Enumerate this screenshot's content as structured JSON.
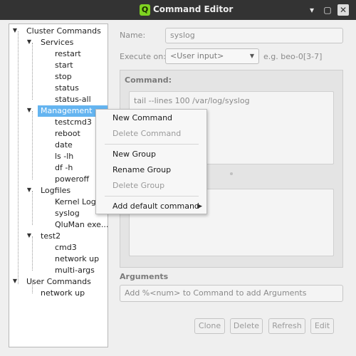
{
  "window": {
    "title": "Command Editor",
    "app_icon_letter": "Q",
    "minimize_glyph": "▾",
    "maximize_glyph": "▢",
    "close_glyph": "✕"
  },
  "tree": {
    "cluster_commands": "Cluster Commands",
    "services": "Services",
    "services_items": [
      "restart",
      "start",
      "stop",
      "status",
      "status-all"
    ],
    "management": "Management",
    "management_items": [
      "testcmd3",
      "reboot",
      "date",
      "ls -lh",
      "df -h",
      "poweroff"
    ],
    "logfiles": "Logfiles",
    "logfiles_items": [
      "Kernel Log",
      "syslog",
      "QluMan exe..."
    ],
    "test2": "test2",
    "test2_items": [
      "cmd3",
      "network up",
      "multi-args"
    ],
    "user_commands": "User Commands",
    "user_items": [
      "network up"
    ]
  },
  "form": {
    "name_label": "Name:",
    "name_value": "syslog",
    "execute_label": "Execute on:",
    "execute_value": "<User input>",
    "execute_example": "e.g. beo-0[3-7]",
    "command_title": "Command:",
    "command_value": "tail --lines 100 /var/log/syslog",
    "arguments_title": "Arguments",
    "arguments_placeholder": "Add %<num> to Command to add Arguments"
  },
  "buttons": {
    "clone": "Clone",
    "delete": "Delete",
    "refresh": "Refresh",
    "edit": "Edit"
  },
  "context_menu": {
    "new_command": "New Command",
    "delete_command": "Delete Command",
    "new_group": "New Group",
    "rename_group": "Rename Group",
    "delete_group": "Delete Group",
    "add_default_command": "Add default command"
  },
  "colors": {
    "titlebar": "#333333",
    "selection": "#64b4f0",
    "app_icon": "#7fd321"
  }
}
